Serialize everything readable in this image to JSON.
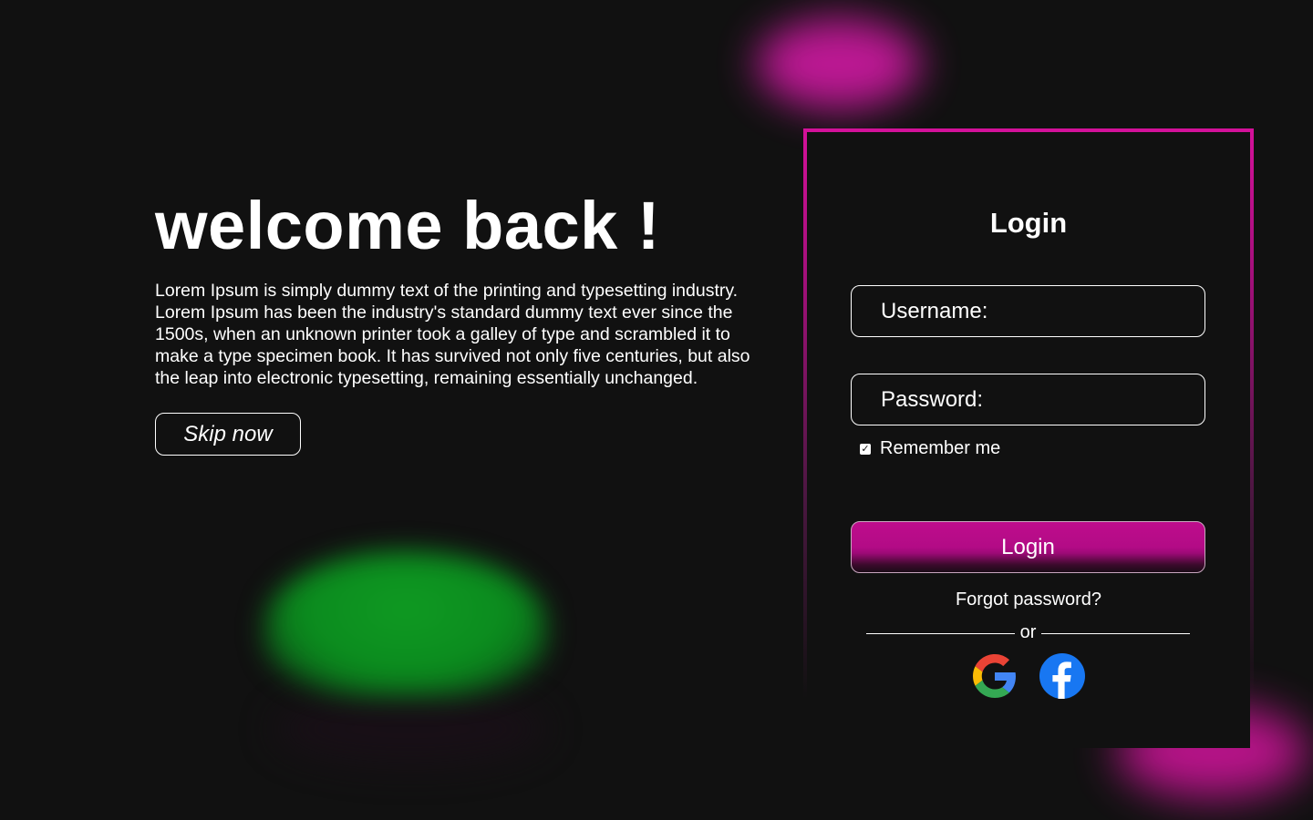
{
  "hero": {
    "title": "welcome back !",
    "description": "Lorem Ipsum is simply dummy text of the printing and typesetting industry. Lorem Ipsum has been the industry's standard dummy text ever since the 1500s, when an unknown printer took a galley of type and scrambled it to make a type specimen book. It has survived not only five centuries, but also the leap into electronic typesetting, remaining essentially unchanged.",
    "skip_label": "Skip now"
  },
  "login": {
    "title": "Login",
    "username_placeholder": "Username:",
    "password_placeholder": "Password:",
    "remember_label": "Remember me",
    "remember_checked": true,
    "submit_label": "Login",
    "forgot_label": "Forgot password?",
    "divider_label": "or",
    "social": [
      {
        "name": "google",
        "icon": "google-icon"
      },
      {
        "name": "facebook",
        "icon": "facebook-icon"
      }
    ]
  },
  "colors": {
    "background": "#111111",
    "accent": "#c0148f",
    "green_glow": "#0b8a1e",
    "text": "#ffffff",
    "facebook_blue": "#1877f2"
  }
}
